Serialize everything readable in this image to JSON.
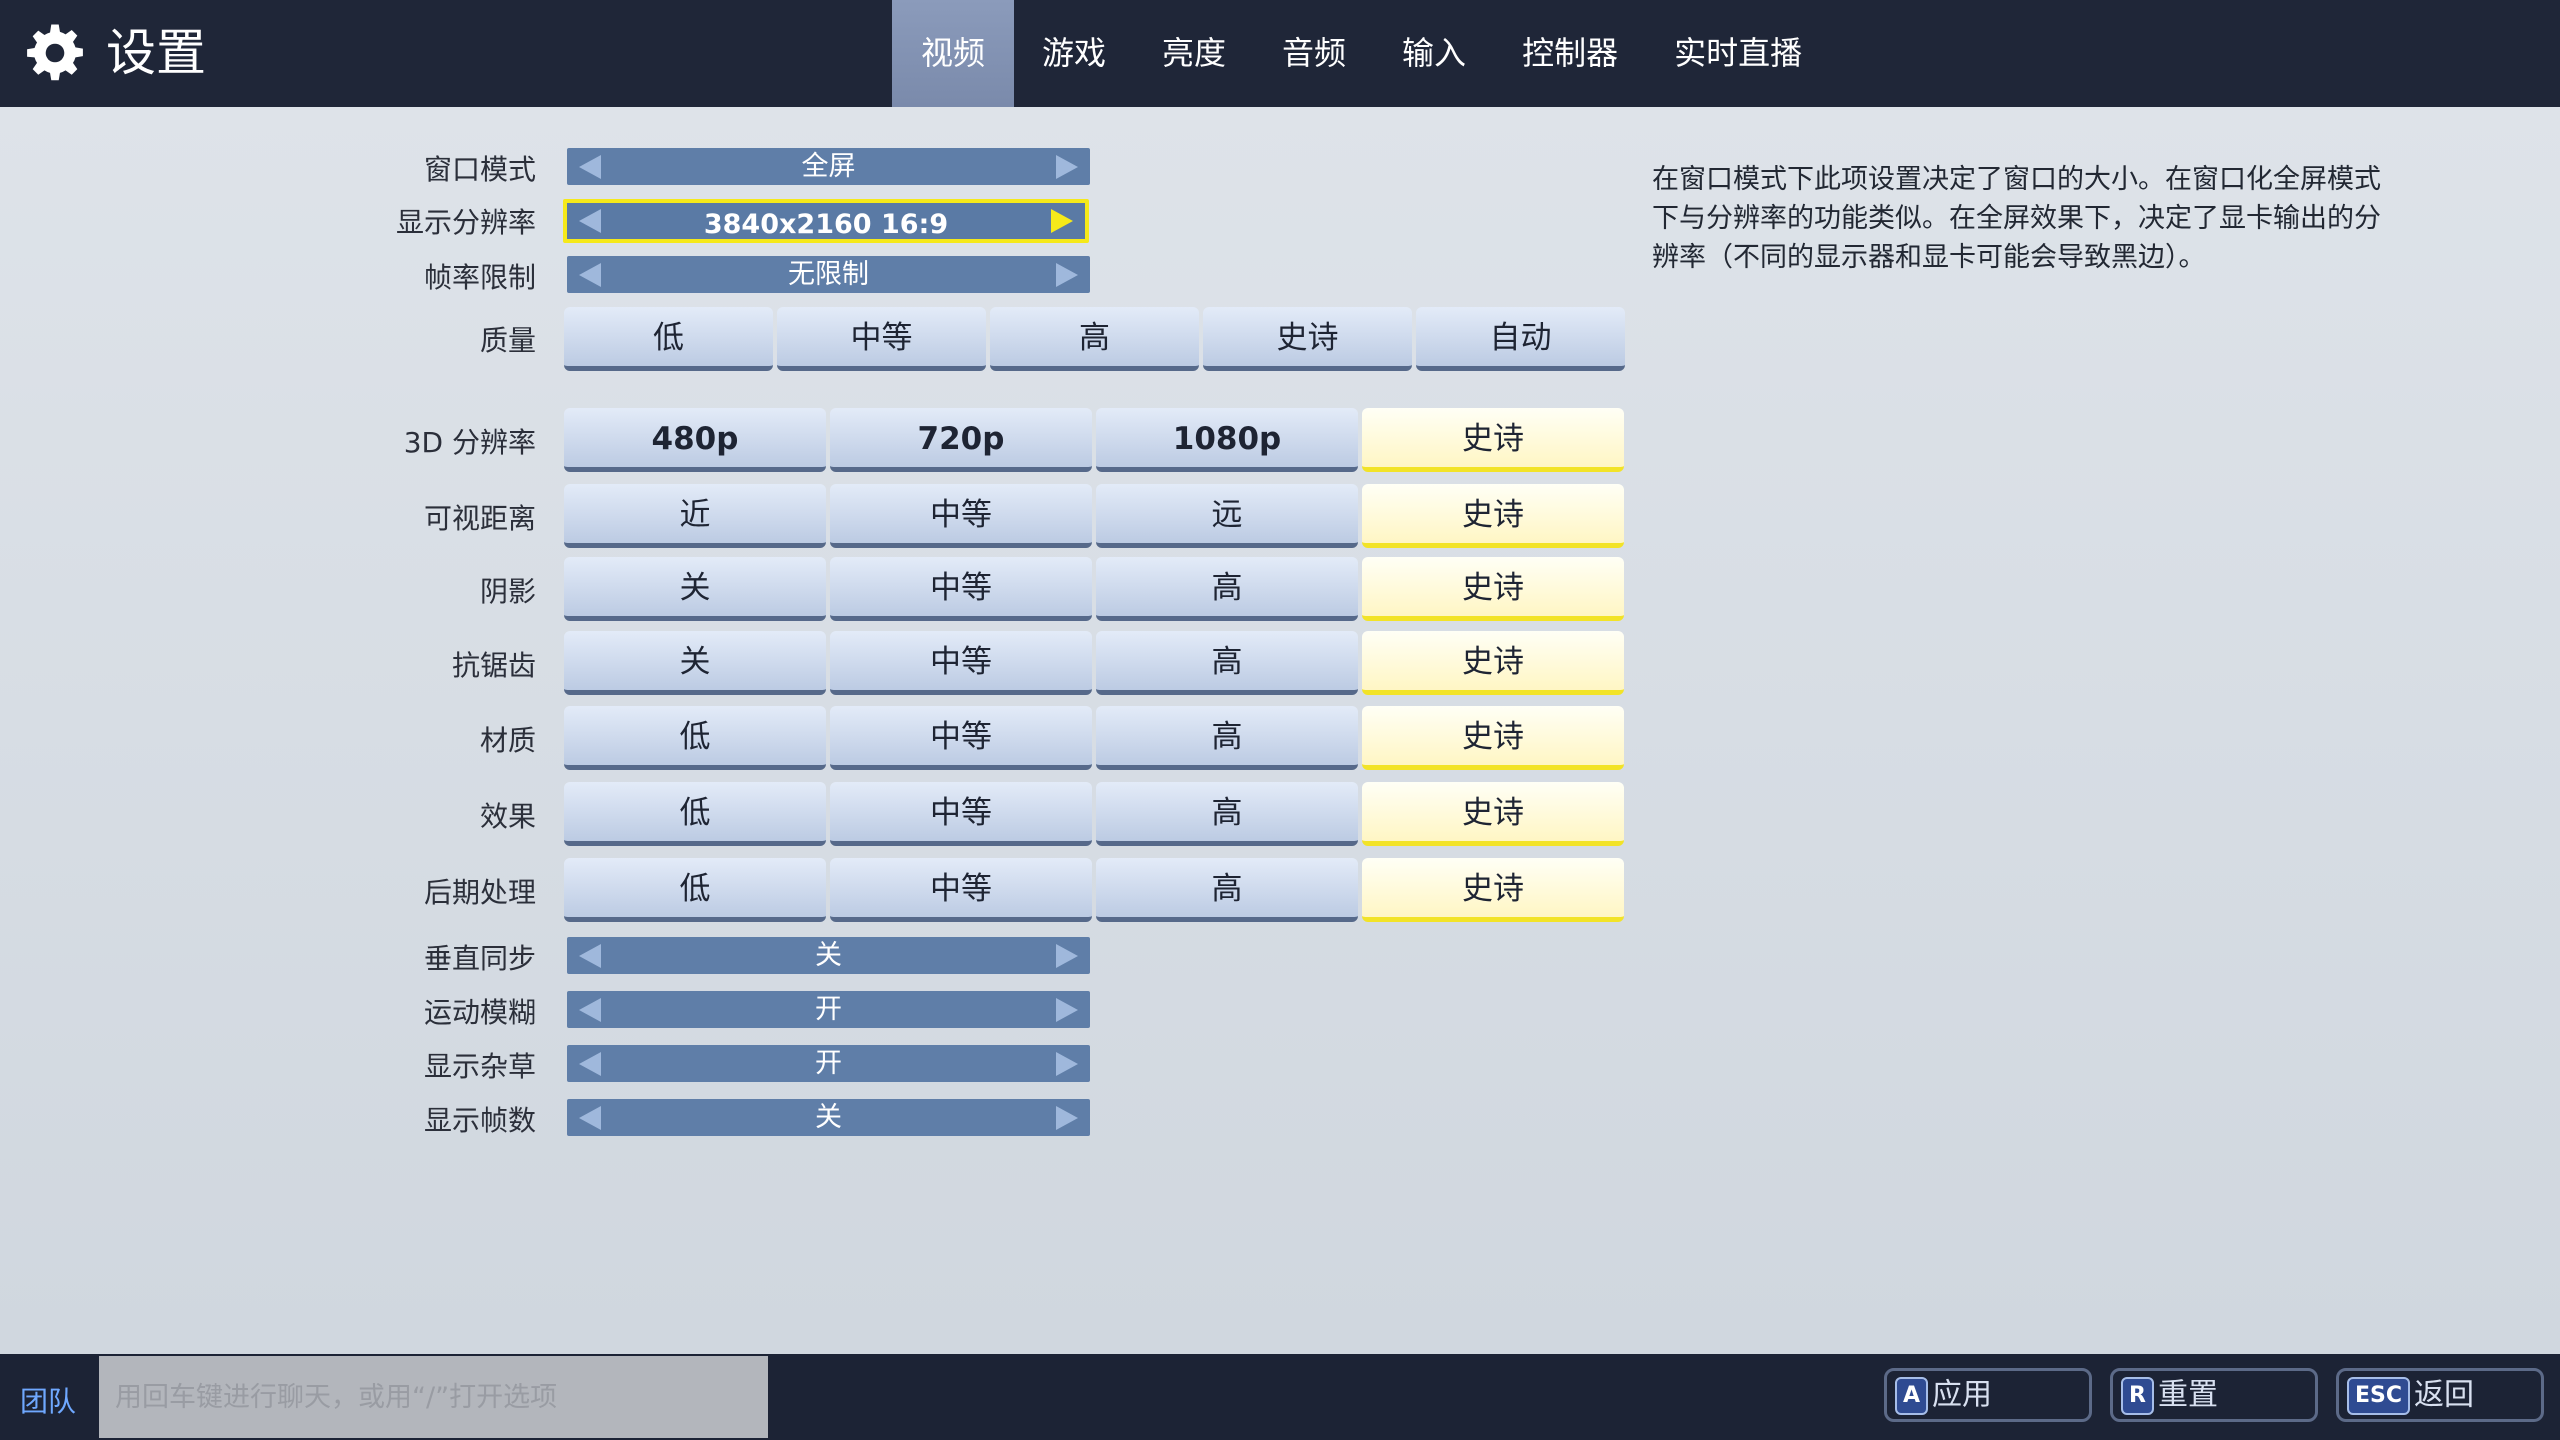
{
  "header": {
    "title": "设置",
    "tabs": [
      {
        "label": "视频",
        "active": true
      },
      {
        "label": "游戏"
      },
      {
        "label": "亮度"
      },
      {
        "label": "音频"
      },
      {
        "label": "输入"
      },
      {
        "label": "控制器"
      },
      {
        "label": "实时直播"
      }
    ]
  },
  "settings": {
    "window_mode": {
      "label": "窗口模式",
      "value": "全屏"
    },
    "resolution": {
      "label": "显示分辨率",
      "value": "3840x2160 16:9"
    },
    "frame_limit": {
      "label": "帧率限制",
      "value": "无限制"
    },
    "quality": {
      "label": "质量",
      "options": [
        "低",
        "中等",
        "高",
        "史诗",
        "自动"
      ]
    },
    "res3d": {
      "label": "3D 分辨率",
      "options": [
        "480p",
        "720p",
        "1080p",
        "史诗"
      ],
      "selected": "史诗"
    },
    "view_distance": {
      "label": "可视距离",
      "options": [
        "近",
        "中等",
        "远",
        "史诗"
      ],
      "selected": "史诗"
    },
    "shadows": {
      "label": "阴影",
      "options": [
        "关",
        "中等",
        "高",
        "史诗"
      ],
      "selected": "史诗"
    },
    "anti_aliasing": {
      "label": "抗锯齿",
      "options": [
        "关",
        "中等",
        "高",
        "史诗"
      ],
      "selected": "史诗"
    },
    "textures": {
      "label": "材质",
      "options": [
        "低",
        "中等",
        "高",
        "史诗"
      ],
      "selected": "史诗"
    },
    "effects": {
      "label": "效果",
      "options": [
        "低",
        "中等",
        "高",
        "史诗"
      ],
      "selected": "史诗"
    },
    "post_processing": {
      "label": "后期处理",
      "options": [
        "低",
        "中等",
        "高",
        "史诗"
      ],
      "selected": "史诗"
    },
    "vsync": {
      "label": "垂直同步",
      "value": "关"
    },
    "motion_blur": {
      "label": "运动模糊",
      "value": "开"
    },
    "show_grass": {
      "label": "显示杂草",
      "value": "开"
    },
    "show_fps": {
      "label": "显示帧数",
      "value": "关"
    }
  },
  "description": "在窗口模式下此项设置决定了窗口的大小。在窗口化全屏模式下与分辨率的功能类似。在全屏效果下，决定了显卡输出的分辨率（不同的显示器和显卡可能会导致黑边）。",
  "footer": {
    "team_label": "团队",
    "chat_placeholder": "用回车键进行聊天，或用“/”打开选项",
    "actions": [
      {
        "key": "A",
        "label": "应用"
      },
      {
        "key": "R",
        "label": "重置"
      },
      {
        "key": "ESC",
        "label": "返回"
      }
    ]
  },
  "colors": {
    "header_bg": "#1f2638",
    "selector_bg": "#5f7ea8",
    "focus_yellow": "#f5e91a",
    "selected_bg": "#fff6c4"
  }
}
